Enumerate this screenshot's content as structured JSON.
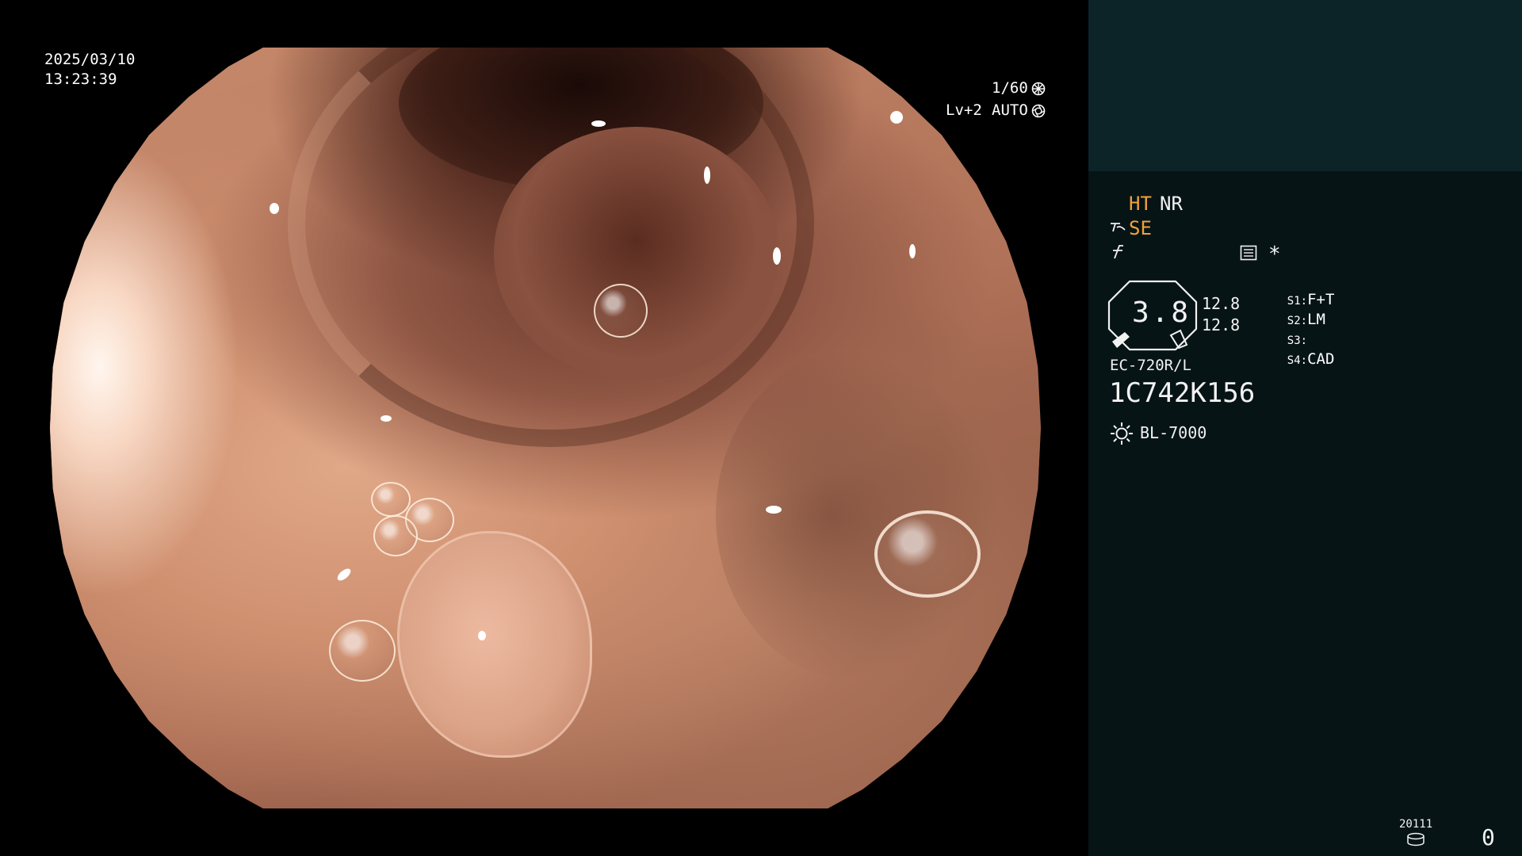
{
  "video": {
    "date": "2025/03/10",
    "time": "13:23:39",
    "shutter": "1/60",
    "shutter_icon": "shutter-wheel-icon",
    "level": "Lv+2",
    "iris_mode": "AUTO",
    "iris_icon": "iris-icon"
  },
  "panel": {
    "mode_ht": "HT",
    "mode_nr": "NR",
    "mode_se": "SE",
    "se_icon": "enhance-symbol-icon",
    "color_icon": "color-mode-icon",
    "menu_icon": "settings-menu-icon",
    "asterisk": "*",
    "zoom_value": "3.8",
    "scale_top": "12.8",
    "scale_bottom": "12.8",
    "switches": [
      {
        "key": "S1:",
        "value": "F+T"
      },
      {
        "key": "S2:",
        "value": "LM"
      },
      {
        "key": "S3:",
        "value": ""
      },
      {
        "key": "S4:",
        "value": "CAD"
      }
    ],
    "scope_model": "EC-720R/L",
    "scope_serial": "1C742K156",
    "light_source": "BL-7000",
    "light_icon": "lamp-icon",
    "counter_label": "20111",
    "counter_icon": "storage-icon",
    "counter_value": "0",
    "colors": {
      "accent": "#f2a13a",
      "panel_bg": "#071416",
      "panel_top_bg": "#0c2427"
    }
  }
}
